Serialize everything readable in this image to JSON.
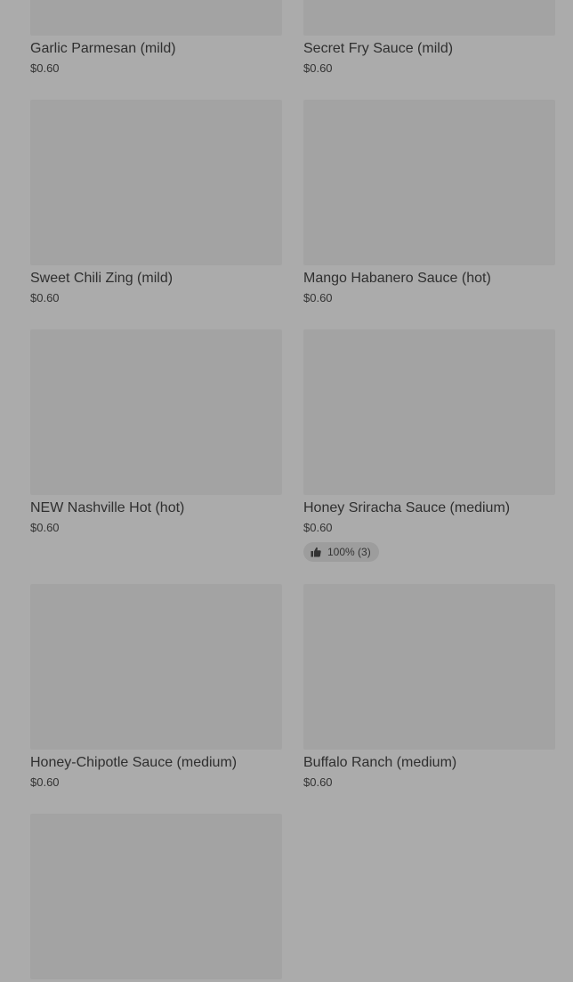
{
  "items": [
    {
      "name": "Garlic Parmesan (mild)",
      "price": "$0.60"
    },
    {
      "name": "Secret Fry Sauce (mild)",
      "price": "$0.60"
    },
    {
      "name": "Sweet Chili Zing (mild)",
      "price": "$0.60"
    },
    {
      "name": "Mango Habanero Sauce (hot)",
      "price": "$0.60"
    },
    {
      "name": "NEW Nashville Hot (hot)",
      "price": "$0.60"
    },
    {
      "name": "Honey Sriracha Sauce (medium)",
      "price": "$0.60",
      "rating": "100% (3)"
    },
    {
      "name": "Honey-Chipotle Sauce (medium)",
      "price": "$0.60"
    },
    {
      "name": "Buffalo Ranch (medium)",
      "price": "$0.60"
    },
    {
      "name": "",
      "price": ""
    }
  ],
  "colors": {
    "overlay_background": "#ababab",
    "image_placeholder": "#a3a3a3",
    "rating_pill": "#9d9d9d"
  },
  "icons": {
    "rating": "thumbs-up-icon"
  }
}
